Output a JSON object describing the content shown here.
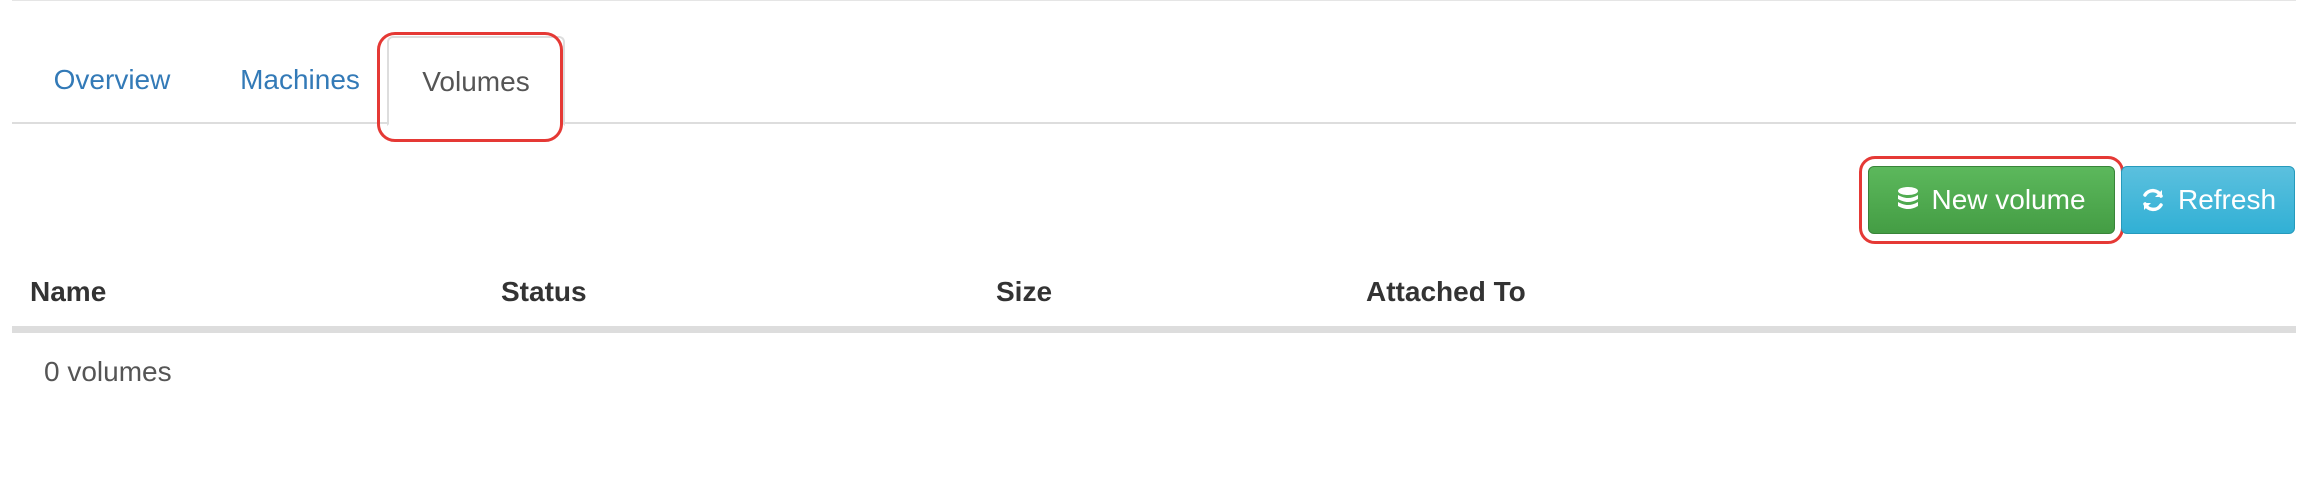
{
  "tabs": [
    {
      "label": "Overview"
    },
    {
      "label": "Machines"
    },
    {
      "label": "Volumes",
      "active": true
    }
  ],
  "toolbar": {
    "new_volume_label": "New volume",
    "new_volume_icon": "database-icon",
    "refresh_label": "Refresh",
    "refresh_icon": "refresh-icon"
  },
  "table": {
    "columns": [
      "Name",
      "Status",
      "Size",
      "Attached To"
    ],
    "rows": [],
    "empty_text": "0 volumes"
  },
  "colors": {
    "link": "#337ab7",
    "success": "#5cb85c",
    "info": "#5bc0de",
    "annotation": "#e53935"
  }
}
